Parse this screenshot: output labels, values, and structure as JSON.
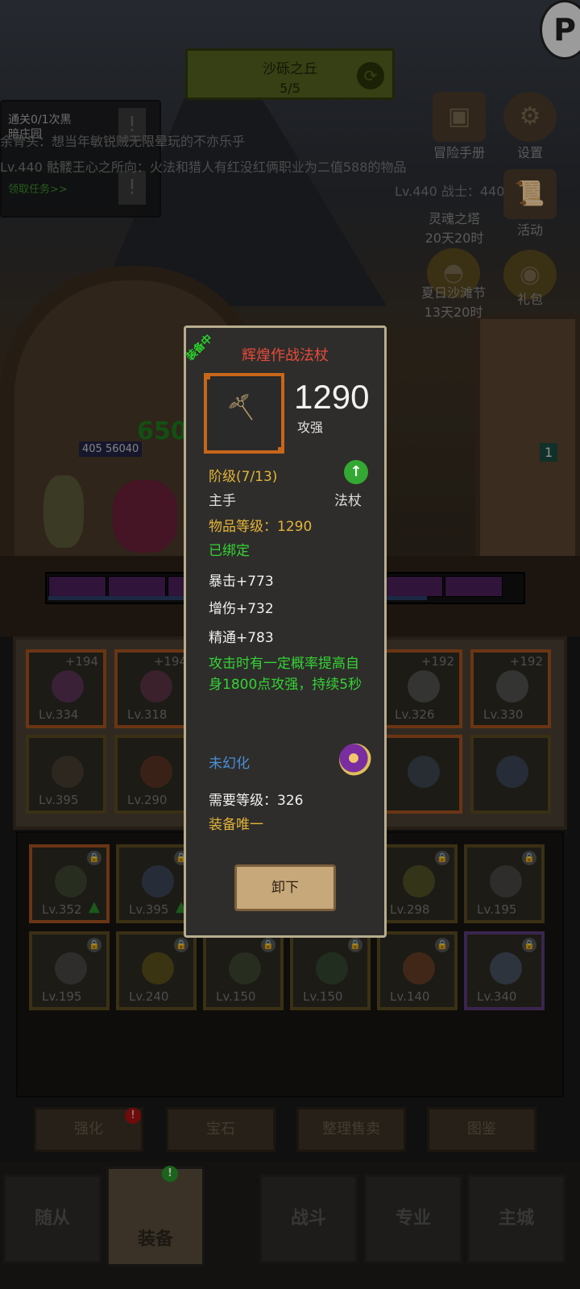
{
  "region": {
    "name": "沙砾之丘",
    "progress": "5/5"
  },
  "quests": {
    "line1": "通关0/1次黑",
    "line2": "暗庄园",
    "claim": "领取任务>>"
  },
  "chat": [
    "余骨头：想当年敏锐贼无限晕玩的不亦乐乎",
    "Lv.440 骷髅王心之所向：火法和猎人有红没红俩职业为二值588的物品",
    "Lv.440 战士：440 有没有"
  ],
  "side_menu": {
    "adventure_book": "冒险手册",
    "settings": "设置",
    "soul_tower": "灵魂之塔",
    "soul_tower_time": "20天20时",
    "activity": "活动",
    "summer_beach": "夏日沙滩节",
    "summer_beach_time": "13天20时",
    "gift_pack": "礼包"
  },
  "battle": {
    "hero_level": "405",
    "hero_hp": "56040",
    "hero_damage": "650",
    "enemy_count": "1"
  },
  "equipment_slots": [
    {
      "lv": "Lv.334",
      "plus": "+194"
    },
    {
      "lv": "Lv.318",
      "plus": "+194"
    },
    {
      "lv": "Lv.326",
      "plus": "+192"
    },
    {
      "lv": "Lv.330",
      "plus": "+192"
    },
    {
      "lv": "Lv.395",
      "plus": ""
    },
    {
      "lv": "Lv.290",
      "plus": ""
    }
  ],
  "bag_slots": [
    {
      "lv": "Lv.352"
    },
    {
      "lv": "Lv.395"
    },
    {
      "lv": "Lv.298"
    },
    {
      "lv": "Lv.195"
    },
    {
      "lv": "Lv.195"
    },
    {
      "lv": "Lv.240"
    },
    {
      "lv": "Lv.150"
    },
    {
      "lv": "Lv.150"
    },
    {
      "lv": "Lv.140"
    },
    {
      "lv": "Lv.340"
    }
  ],
  "actions": {
    "enhance": "强化",
    "gems": "宝石",
    "sort_sell": "整理售卖",
    "codex": "图鉴"
  },
  "bottom_nav": {
    "followers": "随从",
    "equipment": "装备",
    "combat": "战斗",
    "profession": "专业",
    "main_city": "主城"
  },
  "badge_text": "!",
  "tooltip": {
    "equipped": "装备中",
    "name": "辉煌作战法杖",
    "item_level_big": "1290",
    "item_level_caption": "攻强",
    "tier": "阶级(7/13)",
    "slot": "主手",
    "type": "法杖",
    "item_level": "物品等级：1290",
    "bound": "已绑定",
    "stats": [
      "暴击+773",
      "增伤+732",
      "精通+783"
    ],
    "effect": "攻击时有一定概率提高自身1800点攻强，持续5秒",
    "transmog": "未幻化",
    "required_level": "需要等级：326",
    "unique": "装备唯一",
    "unequip_button": "卸下"
  },
  "colors": {
    "item_name": "#e84a3a",
    "tier_gold": "#e3b43a",
    "bound_green": "#34d234",
    "transmog_blue": "#4a8ed8",
    "border": "#b7ad8e"
  }
}
